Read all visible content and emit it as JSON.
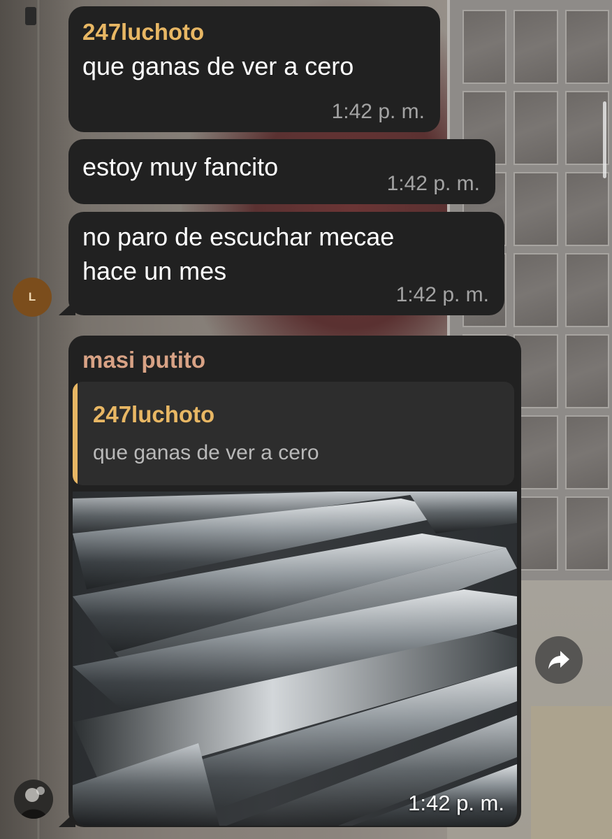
{
  "messages": [
    {
      "sender": "247luchoto",
      "text": "que ganas de ver a cero",
      "time": "1:42 p. m."
    },
    {
      "text": "estoy muy fancito",
      "time": "1:42 p. m."
    },
    {
      "text_lines": [
        "no paro de escuchar mecae",
        "hace un mes"
      ],
      "time": "1:42 p. m.",
      "avatar_initial": "L"
    },
    {
      "sender": "masi putito",
      "reply": {
        "sender": "247luchoto",
        "text": "que ganas de ver a cero"
      },
      "image": "photo of steel bars",
      "time": "1:42 p. m."
    }
  ],
  "icons": {
    "share": "share-arrow-icon"
  },
  "colors": {
    "bubble": "#212121",
    "sender_1": "#e8b764",
    "sender_2": "#d8a285",
    "timestamp": "#a3a3a3",
    "avatar_l": "#7b4d1c"
  }
}
